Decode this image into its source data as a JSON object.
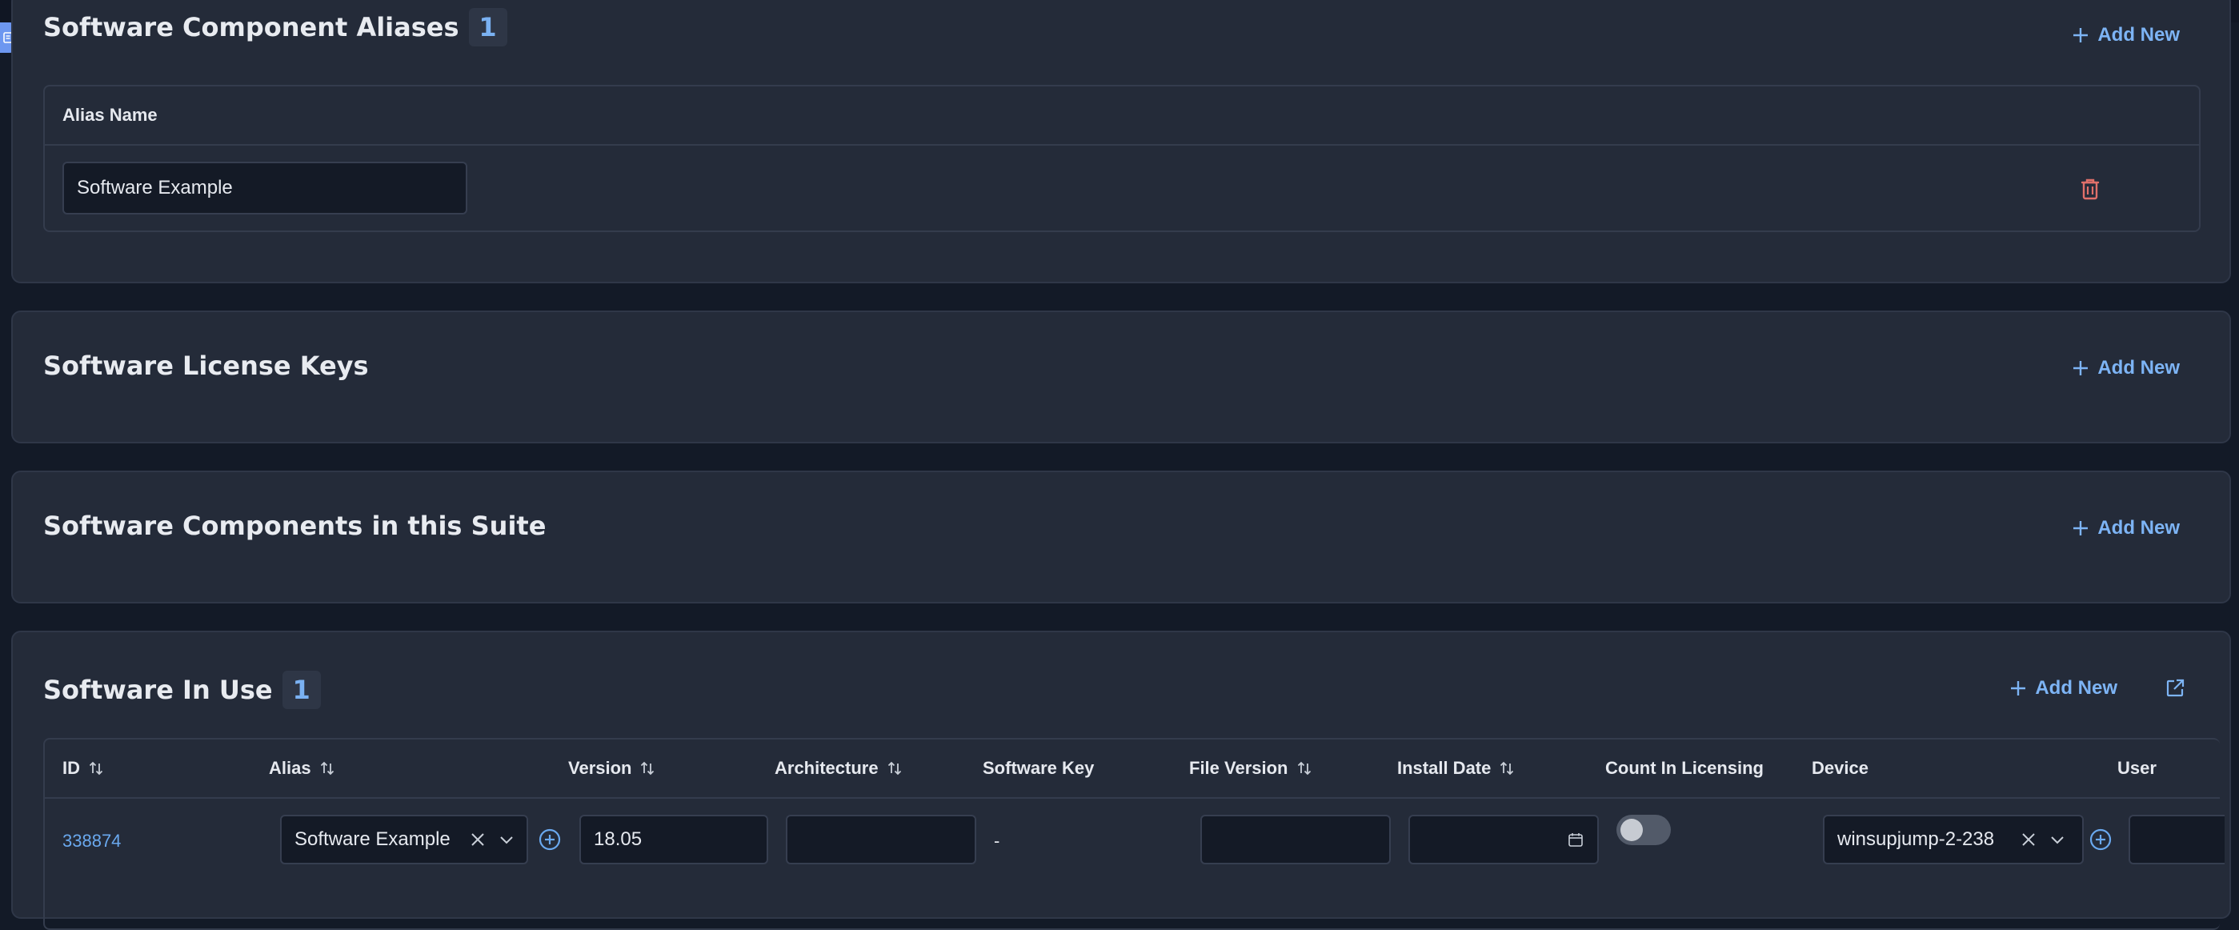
{
  "sections": {
    "aliases": {
      "title": "Software Component Aliases",
      "count": "1",
      "add_label": "Add New",
      "column": "Alias Name",
      "row_value": "Software Example"
    },
    "license_keys": {
      "title": "Software License Keys",
      "add_label": "Add New"
    },
    "components_in_suite": {
      "title": "Software Components in this Suite",
      "add_label": "Add New"
    },
    "in_use": {
      "title": "Software In Use",
      "count": "1",
      "add_label": "Add New",
      "columns": {
        "id": "ID",
        "alias": "Alias",
        "version": "Version",
        "architecture": "Architecture",
        "software_key": "Software Key",
        "file_version": "File Version",
        "install_date": "Install Date",
        "count_in_licensing": "Count In Licensing",
        "device": "Device",
        "user": "User"
      },
      "row": {
        "id": "338874",
        "alias": "Software Example",
        "version": "18.05",
        "architecture": "",
        "software_key": "-",
        "file_version": "",
        "install_date": "",
        "count_in_licensing": false,
        "device": "winsupjump-2-238",
        "user": ""
      }
    }
  },
  "colors": {
    "accent": "#7db4f5",
    "link": "#6aa9ef",
    "danger": "#e0706a",
    "panel": "#242b39",
    "background": "#131a27"
  }
}
